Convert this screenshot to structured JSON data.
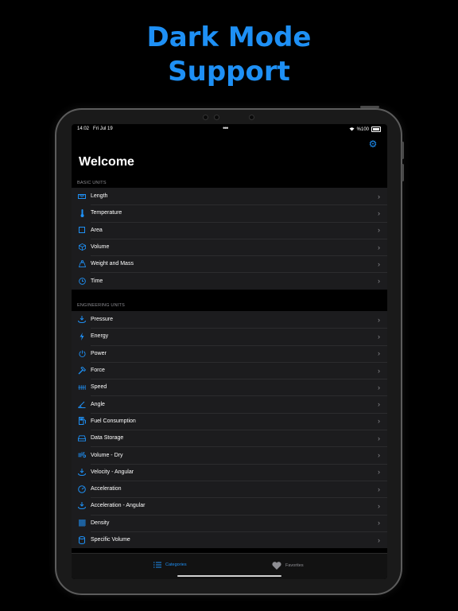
{
  "headline": {
    "line1": "Dark Mode",
    "line2": "Support"
  },
  "status_bar": {
    "time": "14:02",
    "date": "Fri Jul 19",
    "battery": "%100"
  },
  "settings_icon": "gear-icon",
  "page_title": "Welcome",
  "basic_units": {
    "header": "BASIC UNITS",
    "items": [
      {
        "label": "Length",
        "icon": "ruler-icon"
      },
      {
        "label": "Temperature",
        "icon": "thermometer-icon"
      },
      {
        "label": "Area",
        "icon": "square-icon"
      },
      {
        "label": "Volume",
        "icon": "cube-icon"
      },
      {
        "label": "Weight and Mass",
        "icon": "weight-icon"
      },
      {
        "label": "Time",
        "icon": "clock-icon"
      }
    ]
  },
  "engineering_units": {
    "header": "ENGINEERING UNITS",
    "items": [
      {
        "label": "Pressure",
        "icon": "pressure-icon"
      },
      {
        "label": "Energy",
        "icon": "bolt-icon"
      },
      {
        "label": "Power",
        "icon": "power-icon"
      },
      {
        "label": "Force",
        "icon": "hammer-icon"
      },
      {
        "label": "Speed",
        "icon": "speed-icon"
      },
      {
        "label": "Angle",
        "icon": "angle-icon"
      },
      {
        "label": "Fuel Consumption",
        "icon": "fuel-icon"
      },
      {
        "label": "Data Storage",
        "icon": "drive-icon"
      },
      {
        "label": "Volume - Dry",
        "icon": "wind-icon"
      },
      {
        "label": "Velocity - Angular",
        "icon": "angular-velocity-icon"
      },
      {
        "label": "Acceleration",
        "icon": "gauge-icon"
      },
      {
        "label": "Acceleration - Angular",
        "icon": "angular-acceleration-icon"
      },
      {
        "label": "Density",
        "icon": "grid-icon"
      },
      {
        "label": "Specific Volume",
        "icon": "cylinder-icon"
      }
    ]
  },
  "tabs": [
    {
      "label": "Categories",
      "icon": "list-icon",
      "active": true
    },
    {
      "label": "Favorites",
      "icon": "heart-icon",
      "active": false
    }
  ],
  "colors": {
    "accent": "#1e90f5",
    "background": "#000000",
    "cell": "#1c1c1e"
  }
}
